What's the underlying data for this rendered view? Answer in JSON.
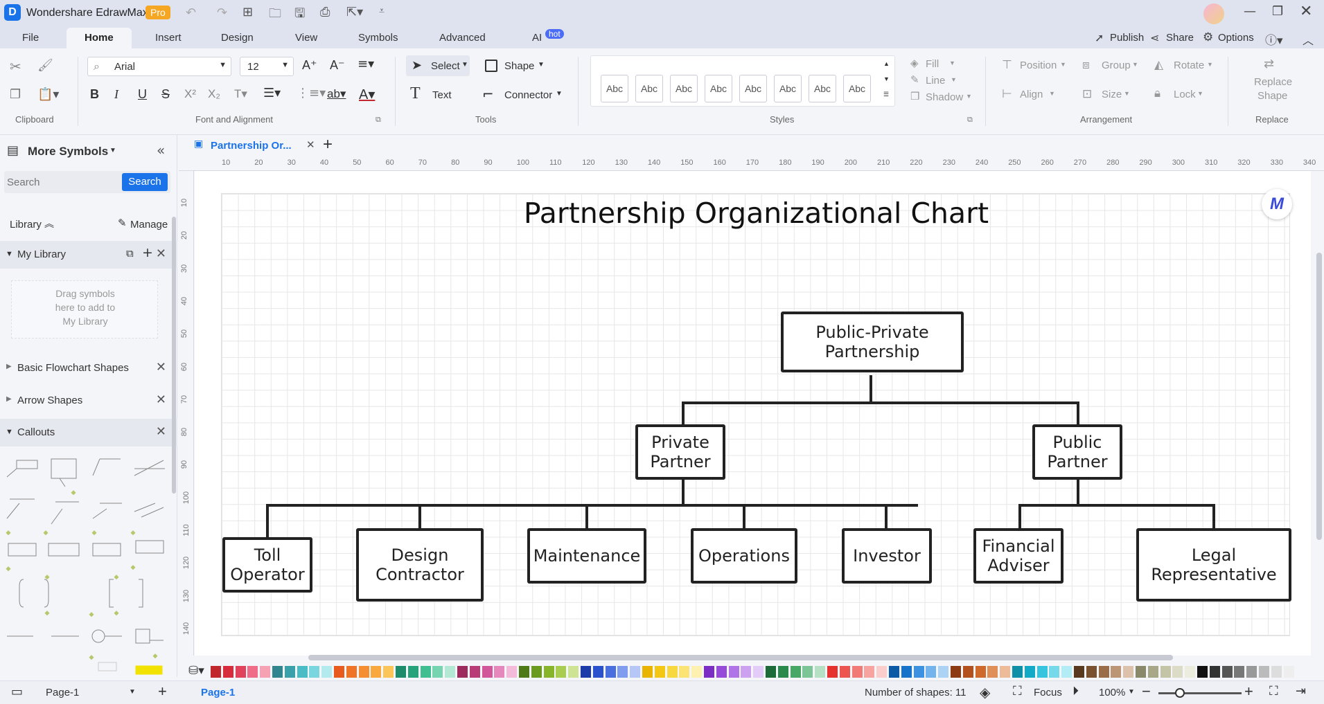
{
  "app": {
    "title": "Wondershare EdrawMax",
    "badge": "Pro",
    "accent": "#1a73e8"
  },
  "menu": {
    "items": [
      "File",
      "Home",
      "Insert",
      "Design",
      "View",
      "Symbols",
      "Advanced",
      "AI"
    ],
    "ai_badge": "hot",
    "right": {
      "publish": "Publish",
      "share": "Share",
      "options": "Options"
    }
  },
  "ribbon": {
    "font_name": "Arial",
    "font_size": "12",
    "select_label": "Select",
    "shape_label": "Shape",
    "text_label": "Text",
    "connector_label": "Connector",
    "style_samples": [
      "Abc",
      "Abc",
      "Abc",
      "Abc",
      "Abc",
      "Abc",
      "Abc",
      "Abc"
    ],
    "fill_label": "Fill",
    "line_label": "Line",
    "shadow_label": "Shadow",
    "position_label": "Position",
    "group_label": "Group",
    "rotate_label": "Rotate",
    "align_label": "Align",
    "size_label": "Size",
    "lock_label": "Lock",
    "replace_shape_label1": "Replace",
    "replace_shape_label2": "Shape",
    "groups": {
      "clipboard": "Clipboard",
      "font": "Font and Alignment",
      "tools": "Tools",
      "styles": "Styles",
      "arrangement": "Arrangement",
      "replace": "Replace"
    }
  },
  "left_panel": {
    "header": "More Symbols",
    "search_placeholder": "Search",
    "search_button": "Search",
    "library_label": "Library",
    "manage_label": "Manage",
    "my_library": "My Library",
    "drop_hint": "Drag symbols\nhere to add to\nMy Library",
    "sections": [
      "Basic Flowchart Shapes",
      "Arrow Shapes",
      "Callouts"
    ]
  },
  "document": {
    "tab_title": "Partnership Or...",
    "chart_title": "Partnership Organizational Chart",
    "nodes": {
      "root": "Public-Private\nPartnership",
      "private": "Private\nPartner",
      "public": "Public\nPartner",
      "toll": "Toll\nOperator",
      "design": "Design\nContractor",
      "maintenance": "Maintenance",
      "operations": "Operations",
      "investor": "Investor",
      "financial": "Financial\nAdviser",
      "legal": "Legal\nRepresentative"
    }
  },
  "ruler": {
    "h_ticks": [
      "10",
      "20",
      "30",
      "40",
      "50",
      "60",
      "70",
      "80",
      "90",
      "100",
      "110",
      "120",
      "130",
      "140",
      "150",
      "160",
      "170",
      "180",
      "190",
      "200",
      "210",
      "220",
      "230",
      "240",
      "250",
      "260",
      "270",
      "280",
      "290",
      "300",
      "310",
      "320",
      "330",
      "340"
    ],
    "v_ticks": [
      "10",
      "20",
      "30",
      "40",
      "50",
      "60",
      "70",
      "80",
      "90",
      "100",
      "110",
      "120",
      "130",
      "140"
    ]
  },
  "palette": [
    "#c0282e",
    "#d62c3b",
    "#e2435c",
    "#f06d8a",
    "#f6a1b4",
    "#31858e",
    "#3aa0aa",
    "#49bcc6",
    "#7ad6de",
    "#b2eaee",
    "#e85a1e",
    "#f07428",
    "#f58e32",
    "#f9a83d",
    "#fbc55a",
    "#1d8c6a",
    "#27a37b",
    "#3fbf91",
    "#77d4b1",
    "#b3e8d4",
    "#9c2a5c",
    "#b83c76",
    "#d2569a",
    "#e688bb",
    "#f3bbd9",
    "#4d7a16",
    "#6a9a1e",
    "#88b42a",
    "#a8cd4f",
    "#cfe394",
    "#1a3ba8",
    "#2a52cc",
    "#4a70e0",
    "#7f9cee",
    "#b6c6f6",
    "#e8b400",
    "#f4c715",
    "#f8d83f",
    "#fbe474",
    "#fdf0b0",
    "#7c2ec4",
    "#964cd8",
    "#b074e6",
    "#cca2f0",
    "#e3cdf8",
    "#1e6b3a",
    "#2a8a4b",
    "#47a865",
    "#7cc596",
    "#b6e0c3",
    "#e5322e",
    "#ec5550",
    "#f27a76",
    "#f7a4a1",
    "#fbcdcb",
    "#0c5aa6",
    "#1773c9",
    "#3c92e0",
    "#74b4ec",
    "#acd3f4",
    "#8c3a12",
    "#b2501e",
    "#d0692c",
    "#e08f58",
    "#eebb98",
    "#0f8fa8",
    "#12aac7",
    "#36c4de",
    "#76d9ea",
    "#b3ecf4",
    "#5a3a1e",
    "#7a5230",
    "#9a6d48",
    "#bc9575",
    "#dcc2ab",
    "#8a8a6a",
    "#a8a888",
    "#c4c4a6",
    "#dcdcc6",
    "#ededdf",
    "#111111",
    "#333333",
    "#555555",
    "#777777",
    "#999999",
    "#bbbbbb",
    "#dddddd",
    "#eeeeee"
  ],
  "status": {
    "page_tab": "Page-1",
    "page_active": "Page-1",
    "shape_count": "Number of shapes: 11",
    "focus": "Focus",
    "zoom": "100%"
  }
}
